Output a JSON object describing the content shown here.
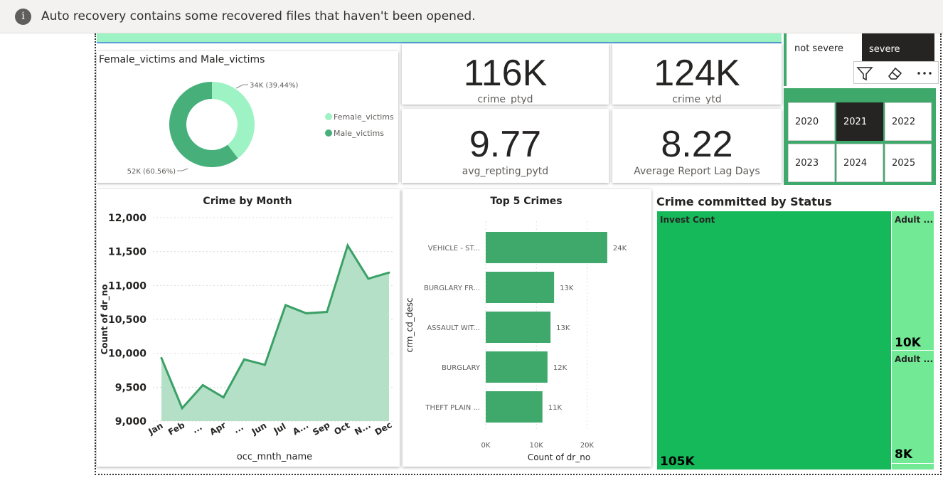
{
  "notice": {
    "icon": "info-icon",
    "text": "Auto recovery contains some recovered files that haven't been opened."
  },
  "kpis": {
    "crime_ptyd": {
      "value": "116K",
      "label": "crime_ptyd"
    },
    "crime_ytd": {
      "value": "124K",
      "label": "crime_ytd"
    },
    "avg_repting_pytd": {
      "value": "9.77",
      "label": "avg_repting_pytd"
    },
    "avg_report_lag": {
      "value": "8.22",
      "label": "Average Report Lag Days"
    }
  },
  "severity_slicer": {
    "options": [
      "not severe",
      "severe"
    ],
    "selected": "severe"
  },
  "visual_header_icons": [
    "filter-icon",
    "eraser-icon",
    "more-options-icon"
  ],
  "year_slicer": {
    "years": [
      "2020",
      "2021",
      "2022",
      "2023",
      "2024",
      "2025"
    ],
    "selected": "2021"
  },
  "colors": {
    "male": "#47b07a",
    "female": "#9df3c4",
    "line": "#3aa065",
    "area": "#b5e0c8",
    "bar": "#3fa86b",
    "treemap_main": "#16b95a",
    "treemap_side": "#72ea95",
    "selected_year": "#252423",
    "banner": "#9df3c4"
  },
  "donut": {
    "title": "Female_victims and Male_victims",
    "legend": [
      "Female_victims",
      "Male_victims"
    ],
    "chart_data": {
      "type": "pie",
      "labels": [
        "Female_victims",
        "Male_victims"
      ],
      "values": [
        34,
        52
      ],
      "data_labels": [
        "34K (39.44%)",
        "52K (60.56%)"
      ],
      "legend_position": "right"
    }
  },
  "line": {
    "title": "Crime by Month",
    "chart_data": {
      "type": "area",
      "categories": [
        "Jan",
        "Feb",
        "Mar",
        "Apr",
        "May",
        "Jun",
        "Jul",
        "Aug",
        "Sep",
        "Oct",
        "Nov",
        "Dec"
      ],
      "tick_labels": [
        "Jan",
        "Feb",
        "...",
        "Apr",
        "...",
        "Jun",
        "Jul",
        "A...",
        "Sep",
        "Oct",
        "N...",
        "Dec"
      ],
      "values": [
        9930,
        9190,
        9530,
        9350,
        9910,
        9830,
        10710,
        10590,
        10610,
        11590,
        11100,
        11190
      ],
      "xlabel": "occ_mnth_name",
      "ylabel": "Count of dr_no",
      "ylim": [
        9000,
        12000
      ],
      "yticks": [
        "12,000",
        "11,500",
        "11,000",
        "10,500",
        "10,000",
        "9,500",
        "9,000"
      ],
      "grid": true
    }
  },
  "bars": {
    "title": "Top 5 Crimes",
    "chart_data": {
      "type": "bar",
      "orientation": "horizontal",
      "categories": [
        "VEHICLE - ST...",
        "BURGLARY FR...",
        "ASSAULT WIT...",
        "BURGLARY",
        "THEFT PLAIN ..."
      ],
      "values": [
        24000,
        13500,
        12800,
        12200,
        11200
      ],
      "data_labels": [
        "24K",
        "13K",
        "13K",
        "12K",
        "11K"
      ],
      "xlabel": "Count of dr_no",
      "ylabel": "crm_cd_desc",
      "xlim": [
        0,
        25000
      ],
      "xticks": [
        "0K",
        "10K",
        "20K"
      ],
      "grid": true
    }
  },
  "treemap": {
    "title": "Crime committed by Status",
    "chart_data": {
      "type": "treemap",
      "labels": [
        "Invest Cont",
        "Adult ...",
        "Adult ..."
      ],
      "values": [
        105,
        10,
        8
      ],
      "data_labels": [
        "105K",
        "10K",
        "8K"
      ]
    }
  }
}
